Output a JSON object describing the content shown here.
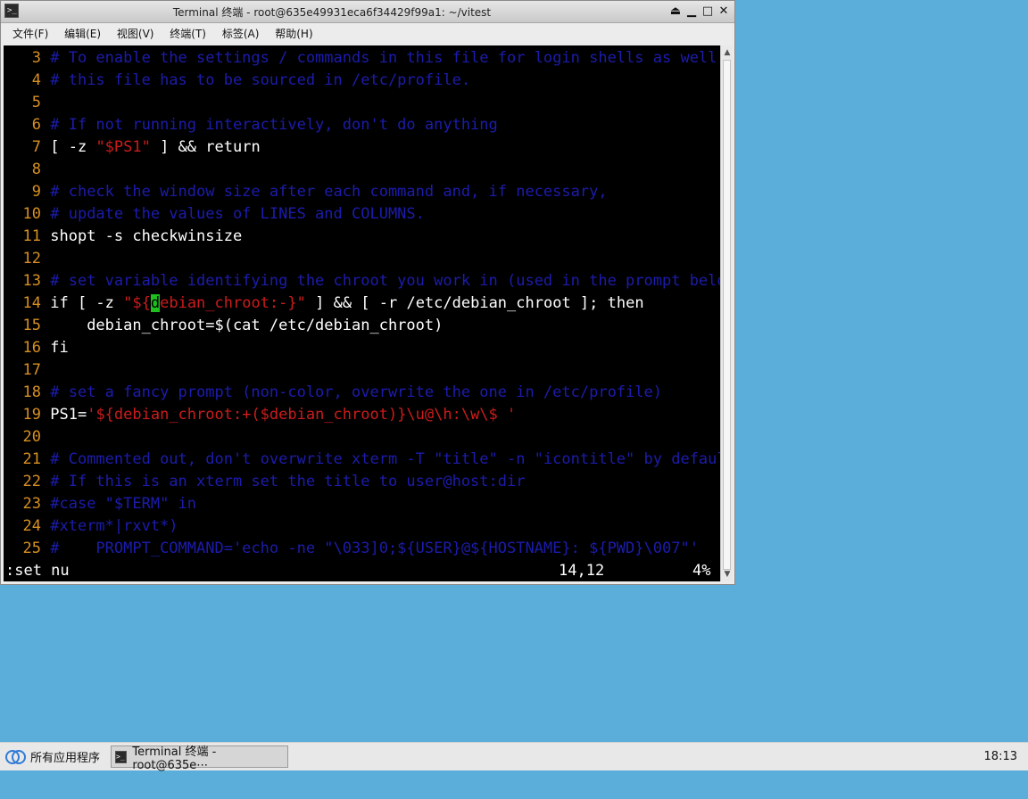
{
  "window": {
    "title": "Terminal 终端 - root@635e49931eca6f34429f99a1: ~/vitest",
    "controls": [
      "⏏",
      "▁",
      "□",
      "✕"
    ]
  },
  "menu": [
    "文件(F)",
    "编辑(E)",
    "视图(V)",
    "终端(T)",
    "标签(A)",
    "帮助(H)"
  ],
  "editor": {
    "lines": [
      {
        "n": "3",
        "parts": [
          [
            "c",
            "# To enable the settings / commands in this file for login shells as well,"
          ]
        ]
      },
      {
        "n": "4",
        "parts": [
          [
            "c",
            "# this file has to be sourced in /etc/profile."
          ]
        ]
      },
      {
        "n": "5",
        "parts": []
      },
      {
        "n": "6",
        "parts": [
          [
            "c",
            "# If not running interactively, don't do anything"
          ]
        ]
      },
      {
        "n": "7",
        "parts": [
          [
            "t",
            "[ -z "
          ],
          [
            "s",
            "\"$PS1\""
          ],
          [
            "t",
            " ] && return"
          ]
        ]
      },
      {
        "n": "8",
        "parts": []
      },
      {
        "n": "9",
        "parts": [
          [
            "c",
            "# check the window size after each command and, if necessary,"
          ]
        ]
      },
      {
        "n": "10",
        "parts": [
          [
            "c",
            "# update the values of LINES and COLUMNS."
          ]
        ]
      },
      {
        "n": "11",
        "parts": [
          [
            "t",
            "shopt -s checkwinsize"
          ]
        ]
      },
      {
        "n": "12",
        "parts": []
      },
      {
        "n": "13",
        "parts": [
          [
            "c",
            "# set variable identifying the chroot you work in (used in the prompt below)"
          ]
        ]
      },
      {
        "n": "14",
        "parts": [
          [
            "t",
            "if [ -z "
          ],
          [
            "s",
            "\"${"
          ],
          [
            "cur",
            "d"
          ],
          [
            "s",
            "ebian_chroot:-}\""
          ],
          [
            "t",
            " ] && [ -r /etc/debian_chroot ]; then"
          ]
        ]
      },
      {
        "n": "15",
        "parts": [
          [
            "t",
            "    debian_chroot=$(cat /etc/debian_chroot)"
          ]
        ]
      },
      {
        "n": "16",
        "parts": [
          [
            "t",
            "fi"
          ]
        ]
      },
      {
        "n": "17",
        "parts": []
      },
      {
        "n": "18",
        "parts": [
          [
            "c",
            "# set a fancy prompt (non-color, overwrite the one in /etc/profile)"
          ]
        ]
      },
      {
        "n": "19",
        "parts": [
          [
            "t",
            "PS1="
          ],
          [
            "s",
            "'${debian_chroot:+($debian_chroot)}\\u@\\h:\\w\\$ '"
          ]
        ]
      },
      {
        "n": "20",
        "parts": []
      },
      {
        "n": "21",
        "parts": [
          [
            "c",
            "# Commented out, don't overwrite xterm -T \"title\" -n \"icontitle\" by default."
          ]
        ]
      },
      {
        "n": "22",
        "parts": [
          [
            "c",
            "# If this is an xterm set the title to user@host:dir"
          ]
        ]
      },
      {
        "n": "23",
        "parts": [
          [
            "c",
            "#case \"$TERM\" in"
          ]
        ]
      },
      {
        "n": "24",
        "parts": [
          [
            "c",
            "#xterm*|rxvt*)"
          ]
        ]
      },
      {
        "n": "25",
        "parts": [
          [
            "c",
            "#    PROMPT_COMMAND='echo -ne \"\\033]0;${USER}@${HOSTNAME}: ${PWD}\\007\"'"
          ]
        ]
      }
    ],
    "command_line": ":set nu",
    "cursor_position": "14,12",
    "scroll_percent": "4%"
  },
  "taskbar": {
    "start_label": "所有应用程序",
    "task_label": "Terminal 终端 - root@635e⋯",
    "clock": "18:13"
  }
}
